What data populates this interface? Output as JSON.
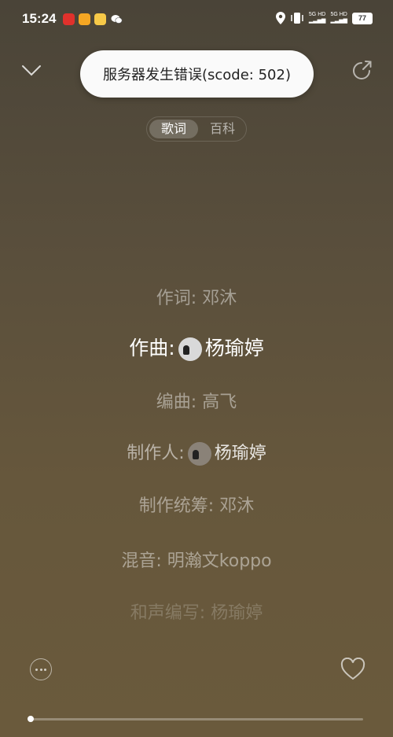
{
  "status_bar": {
    "time": "15:24",
    "net1": "5G HD",
    "net2": "5G HD",
    "battery": "77"
  },
  "toast": "服务器发生错误(scode: 502)",
  "tabs": [
    {
      "label": "歌词",
      "active": true
    },
    {
      "label": "百科",
      "active": false
    }
  ],
  "lyrics": [
    {
      "text": "作词: 邓沐"
    },
    {
      "prefix": "作曲:",
      "name": "杨瑜婷"
    },
    {
      "text": "编曲: 高飞"
    },
    {
      "prefix": "制作人:",
      "name": "杨瑜婷"
    },
    {
      "text": "制作统筹: 邓沐"
    },
    {
      "text": "混音: 明瀚文koppo"
    },
    {
      "text": "和声编写: 杨瑜婷"
    }
  ],
  "progress": 0.0
}
